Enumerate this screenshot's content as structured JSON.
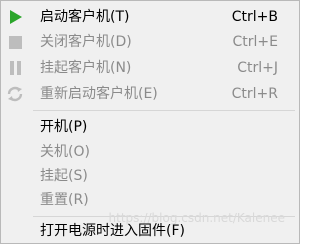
{
  "menu": {
    "items": [
      {
        "label": "启动客户机(T)",
        "shortcut": "Ctrl+B",
        "enabled": true,
        "icon": "play-icon"
      },
      {
        "label": "关闭客户机(D)",
        "shortcut": "Ctrl+E",
        "enabled": false,
        "icon": "stop-icon"
      },
      {
        "label": "挂起客户机(N)",
        "shortcut": "Ctrl+J",
        "enabled": false,
        "icon": "pause-icon"
      },
      {
        "label": "重新启动客户机(E)",
        "shortcut": "Ctrl+R",
        "enabled": false,
        "icon": "restart-icon"
      },
      {
        "label": "开机(P)",
        "shortcut": "",
        "enabled": true
      },
      {
        "label": "关机(O)",
        "shortcut": "",
        "enabled": false
      },
      {
        "label": "挂起(S)",
        "shortcut": "",
        "enabled": false
      },
      {
        "label": "重置(R)",
        "shortcut": "",
        "enabled": false
      },
      {
        "label": "打开电源时进入固件(F)",
        "shortcut": "",
        "enabled": true
      }
    ]
  },
  "watermark": "https://blog.csdn.net/Kalenee",
  "colors": {
    "play_icon": "#2aa52a",
    "disabled_icon": "#bdbdbd",
    "disabled_text": "#8b8b8b",
    "menu_bg": "#f0f0f0"
  }
}
